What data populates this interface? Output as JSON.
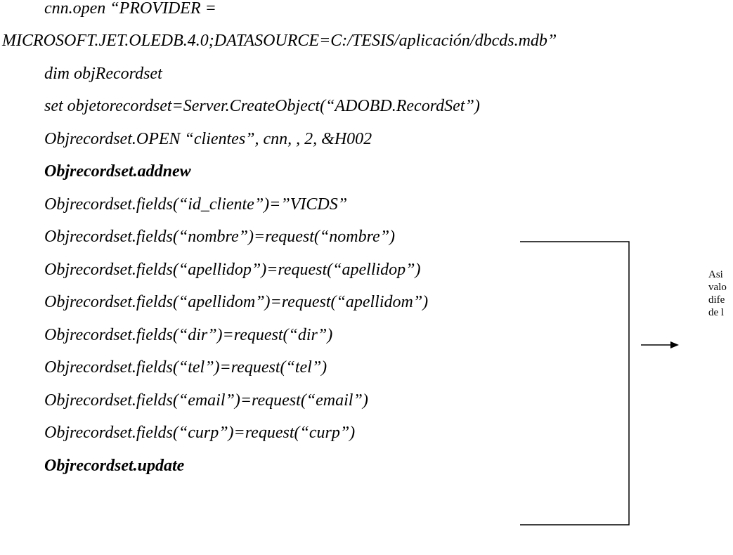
{
  "code_lines": [
    "cnn.open “PROVIDER =",
    "MICROSOFT.JET.OLEDB.4.0;DATASOURCE=C:/TESIS/aplicación/dbcds.mdb”",
    "dim objRecordset",
    "set objetorecordset=Server.CreateObject(“ADOBD.RecordSet”)",
    "Objrecordset.OPEN “clientes”, cnn, , 2, &H002",
    "Objrecordset.addnew",
    "Objrecordset.fields(“id_cliente”)=”VICDS”",
    "Objrecordset.fields(“nombre”)=request(“nombre”)",
    "Objrecordset.fields(“apellidop”)=request(“apellidop”)",
    "Objrecordset.fields(“apellidom”)=request(“apellidom”)",
    "Objrecordset.fields(“dir”)=request(“dir”)",
    "Objrecordset.fields(“tel”)=request(“tel”)",
    "Objrecordset.fields(“email”)=request(“email”)",
    "Objrecordset.fields(“curp”)=request(“curp”)",
    "Objrecordset.update"
  ],
  "annotation": {
    "lines": [
      "Asi",
      "valo",
      "dife",
      "de l"
    ]
  }
}
